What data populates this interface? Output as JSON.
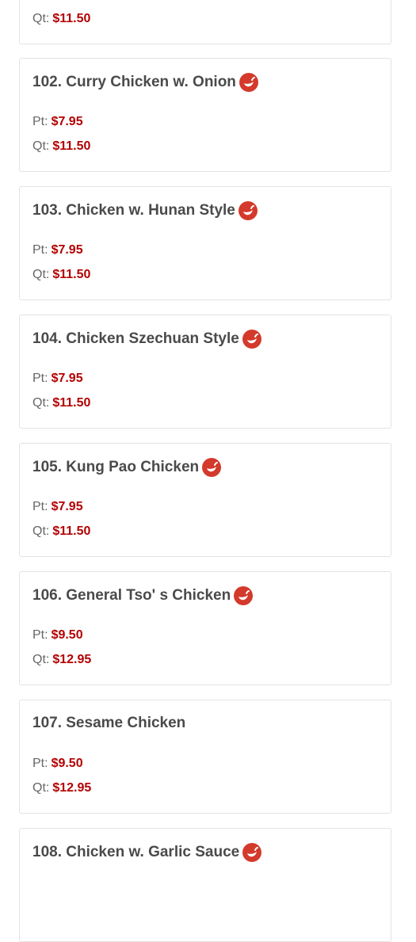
{
  "menu_items": [
    {
      "name": "",
      "spicy": false,
      "prices": [
        {
          "label": "Qt:",
          "value": "$11.50"
        }
      ]
    },
    {
      "name": "102. Curry Chicken w. Onion",
      "spicy": true,
      "prices": [
        {
          "label": "Pt:",
          "value": "$7.95"
        },
        {
          "label": "Qt:",
          "value": "$11.50"
        }
      ]
    },
    {
      "name": "103. Chicken w. Hunan Style",
      "spicy": true,
      "prices": [
        {
          "label": "Pt:",
          "value": "$7.95"
        },
        {
          "label": "Qt:",
          "value": "$11.50"
        }
      ]
    },
    {
      "name": "104. Chicken Szechuan Style",
      "spicy": true,
      "prices": [
        {
          "label": "Pt:",
          "value": "$7.95"
        },
        {
          "label": "Qt:",
          "value": "$11.50"
        }
      ]
    },
    {
      "name": "105. Kung Pao Chicken",
      "spicy": true,
      "prices": [
        {
          "label": "Pt:",
          "value": "$7.95"
        },
        {
          "label": "Qt:",
          "value": "$11.50"
        }
      ]
    },
    {
      "name": "106. General Tso' s Chicken",
      "spicy": true,
      "prices": [
        {
          "label": "Pt:",
          "value": "$9.50"
        },
        {
          "label": "Qt:",
          "value": "$12.95"
        }
      ]
    },
    {
      "name": "107. Sesame Chicken",
      "spicy": false,
      "prices": [
        {
          "label": "Pt:",
          "value": "$9.50"
        },
        {
          "label": "Qt:",
          "value": "$12.95"
        }
      ]
    },
    {
      "name": "108. Chicken w. Garlic Sauce",
      "spicy": true,
      "prices": []
    }
  ],
  "icons": {
    "spicy": "chili-pepper-icon"
  },
  "colors": {
    "price": "#b30000",
    "title": "#4a4a4a",
    "icon": "#d33a2c",
    "border": "#e3e3e3"
  }
}
